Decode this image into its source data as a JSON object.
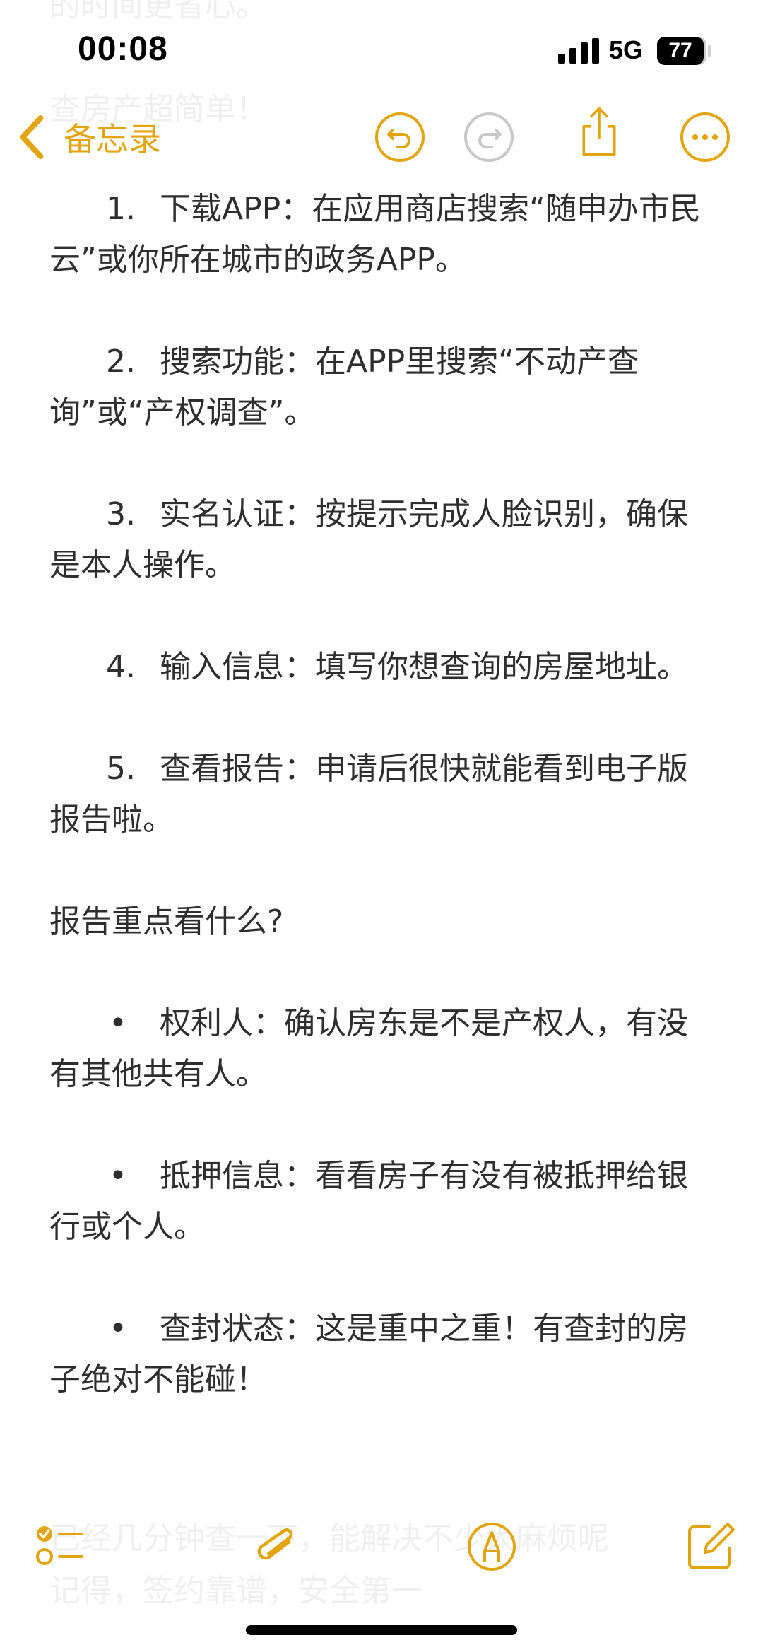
{
  "status_bar": {
    "time": "00:08",
    "network": "5G",
    "battery": "77"
  },
  "nav": {
    "back_label": "备忘录",
    "accent_color": "#e3a50f",
    "icons": [
      "chevron-left-icon",
      "undo-icon",
      "redo-icon",
      "share-icon",
      "more-icon"
    ]
  },
  "note": {
    "faded_text_top": [
      "的时间更省心。",
      "查房产超简单！"
    ],
    "steps": [
      {
        "num": "1.",
        "text": "下载APP：在应用商店搜索“随申办市民云”或你所在城市的政务APP。"
      },
      {
        "num": "2.",
        "text": "搜索功能：在APP里搜索“不动产查询”或“产权调查”。"
      },
      {
        "num": "3.",
        "text": "实名认证：按提示完成人脸识别，确保是本人操作。"
      },
      {
        "num": "4.",
        "text": "输入信息：填写你想查询的房屋地址。"
      },
      {
        "num": "5.",
        "text": "查看报告：申请后很快就能看到电子版报告啦。"
      }
    ],
    "section_heading": "报告重点看什么?",
    "bullets": [
      {
        "mark": "•",
        "text": "权利人：确认房东是不是产权人，有没有其他共有人。"
      },
      {
        "mark": "•",
        "text": "抵押信息：看看房子有没有被抵押给银行或个人。"
      },
      {
        "mark": "•",
        "text": "查封状态：这是重中之重！有查封的房子绝对不能碰！"
      }
    ],
    "faded_text_bottom": [
      "已经几分钟查一下，能解决不少大麻烦呢",
      "记得，签约靠谱，安全第一"
    ]
  },
  "bottom_toolbar": {
    "icons": [
      "checklist-icon",
      "paperclip-icon",
      "markup-pen-icon",
      "compose-icon"
    ]
  }
}
